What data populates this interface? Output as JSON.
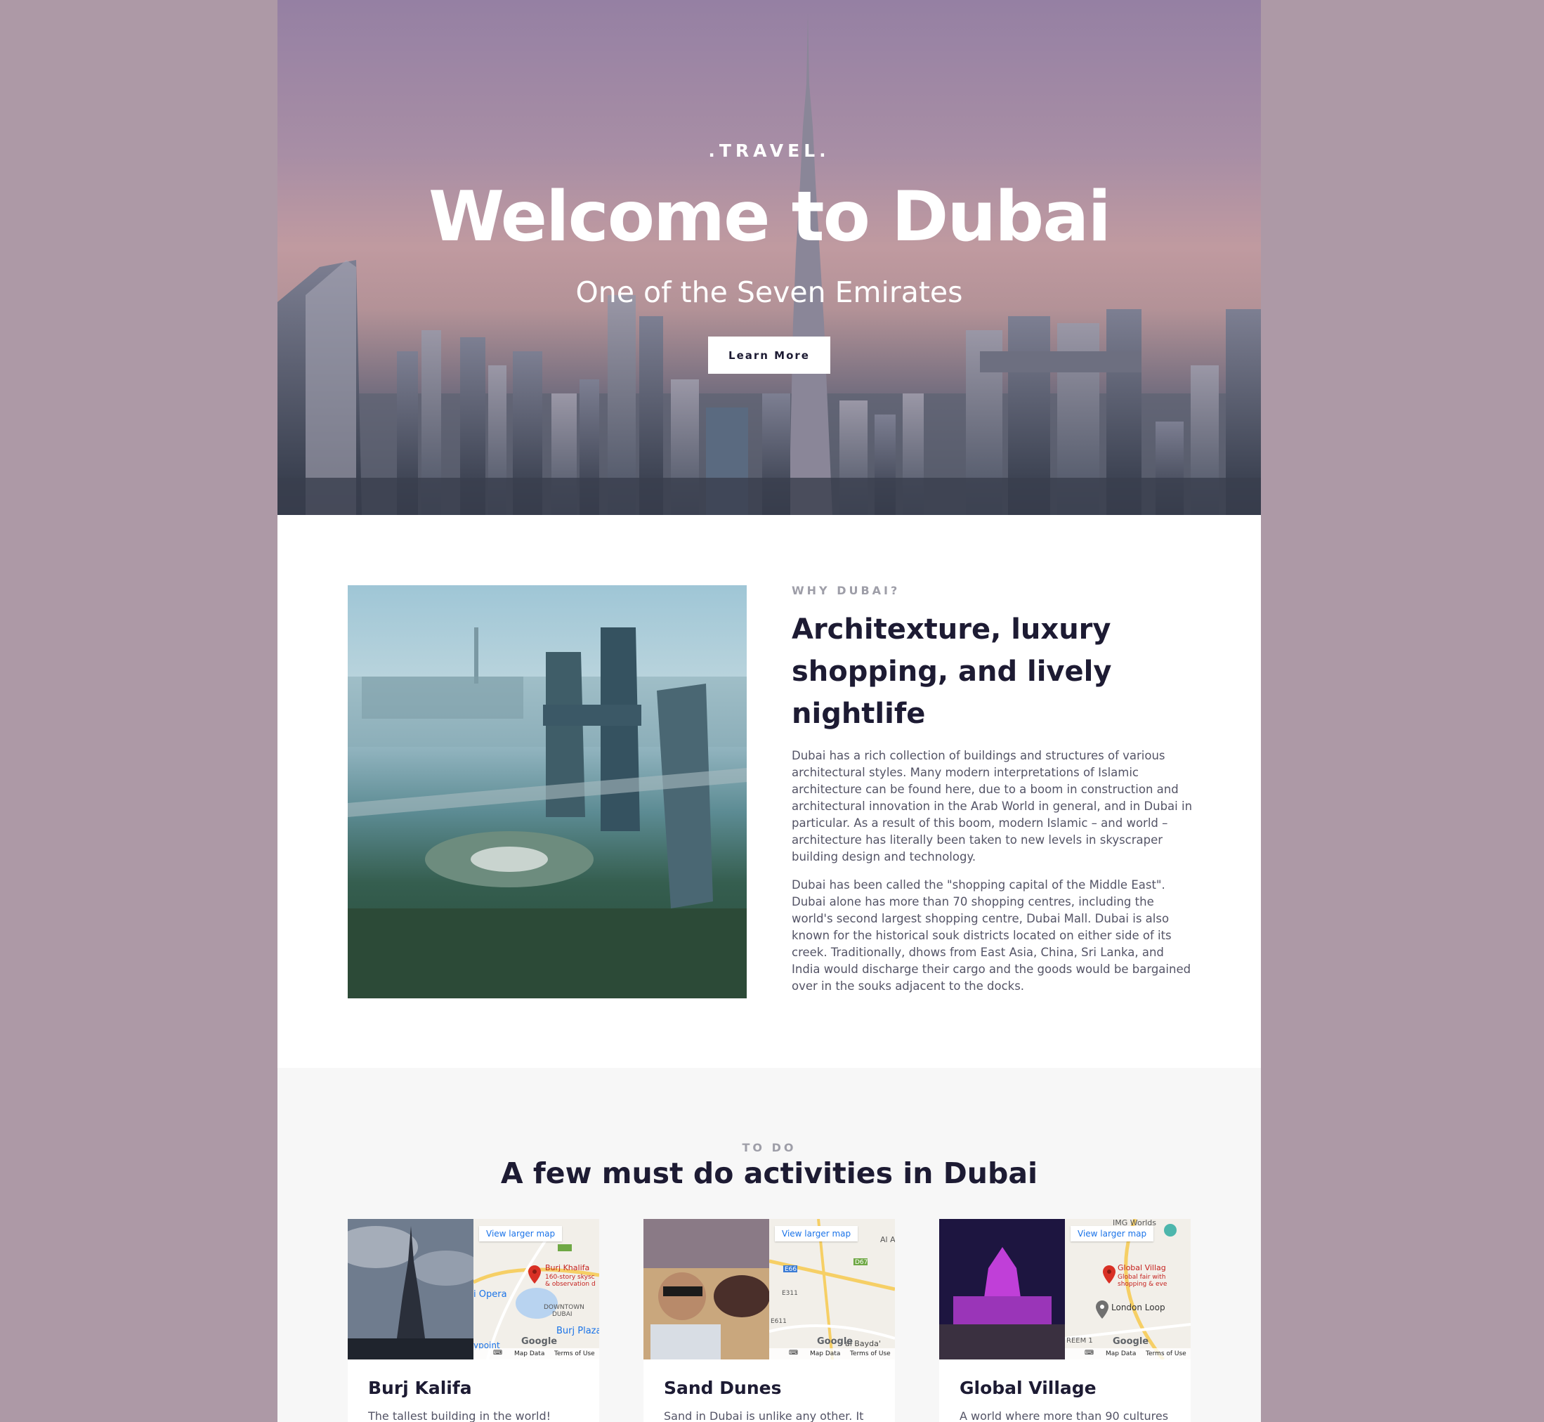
{
  "hero": {
    "eyebrow": ".TRAVEL.",
    "title": "Welcome to Dubai",
    "subtitle": "One of the Seven Emirates",
    "button_label": "Learn More"
  },
  "why": {
    "eyebrow": "WHY DUBAI?",
    "heading": "Architexture, luxury shopping, and lively nightlife",
    "paragraphs": [
      "Dubai has a rich collection of buildings and structures of various architectural styles. Many modern interpretations of Islamic architecture can be found here, due to a boom in construction and architectural innovation in the Arab World in general, and in Dubai in particular. As a result of this boom, modern Islamic – and world – architecture has literally been taken to new levels in skyscraper building design and technology.",
      "Dubai has been called the \"shopping capital of the Middle East\". Dubai alone has more than 70 shopping centres, including the world's second largest shopping centre, Dubai Mall. Dubai is also known for the historical souk districts located on either side of its creek. Traditionally, dhows from East Asia, China, Sri Lanka, and India would discharge their cargo and the goods would be bargained over in the souks adjacent to the docks."
    ]
  },
  "todo": {
    "eyebrow": "TO DO",
    "title": "A few must do activities in Dubai",
    "cards": [
      {
        "title": "Burj Kalifa",
        "description": "The tallest building in the world!",
        "map": {
          "link": "View larger map",
          "labels": [
            "Burj Khalifa",
            "160-story skysc",
            "& observation d",
            "i Opera",
            "DOWNTOWN",
            "DUBAI",
            "Burj Plaza",
            "ypoint"
          ],
          "map_data": "Map Data",
          "terms": "Terms of Use",
          "google": "Google"
        }
      },
      {
        "title": "Sand Dunes",
        "description": "Sand in Dubai is unlike any other. It",
        "map": {
          "link": "View larger map",
          "labels": [
            "Al A",
            "E66",
            "D67",
            "E311",
            "E611",
            "al Bayda'"
          ],
          "map_data": "Map Data",
          "terms": "Terms of Use",
          "google": "Google"
        }
      },
      {
        "title": "Global Village",
        "description": "A world where more than 90 cultures",
        "map": {
          "link": "View larger map",
          "labels": [
            "IMG Worlds",
            "Global Villag",
            "Global fair with",
            "shopping & eve",
            "London Loop",
            "REEM 1"
          ],
          "map_data": "Map Data",
          "terms": "Terms of Use",
          "google": "Google"
        }
      }
    ]
  },
  "colors": {
    "page_background": "#ad99a6",
    "heading": "#1d1b33",
    "body_text": "#545466",
    "eyebrow": "#9e9ea8",
    "section_alt": "#f7f7f7",
    "map_link": "#1a73e8",
    "map_pin": "#d93025"
  }
}
